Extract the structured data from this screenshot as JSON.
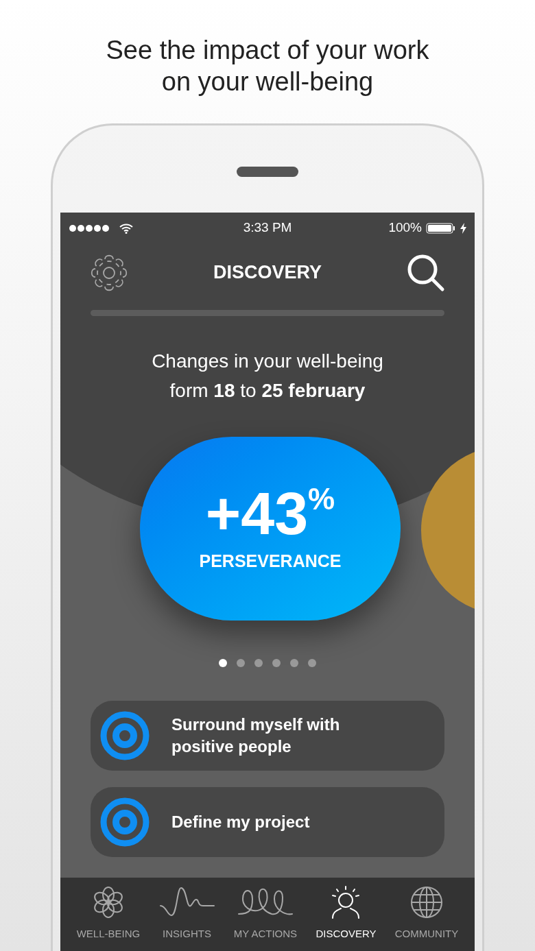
{
  "headline": "See the impact of your work on your well-being",
  "status_bar": {
    "time": "3:33 PM",
    "battery": "100%"
  },
  "header": {
    "title": "DISCOVERY"
  },
  "summary": [
    "Changes in your well-being",
    "form **18** to **25 february**"
  ],
  "card": {
    "value": "+43",
    "unit": "%",
    "label": "PERSEVERANCE"
  },
  "page_dots": [
    {
      "selected": true
    },
    {
      "selected": false
    },
    {
      "selected": false
    },
    {
      "selected": false
    },
    {
      "selected": false
    },
    {
      "selected": false
    }
  ],
  "actions": [
    {
      "title": "Surround myself with positive people"
    },
    {
      "title": "Define my project"
    }
  ],
  "tabs": [
    {
      "label": "WELL-BEING",
      "selected": false
    },
    {
      "label": "INSIGHTS",
      "selected": false
    },
    {
      "label": "MY ACTIONS",
      "selected": false
    },
    {
      "label": "DISCOVERY",
      "selected": true
    },
    {
      "label": "COMMUNITY",
      "selected": false
    }
  ]
}
